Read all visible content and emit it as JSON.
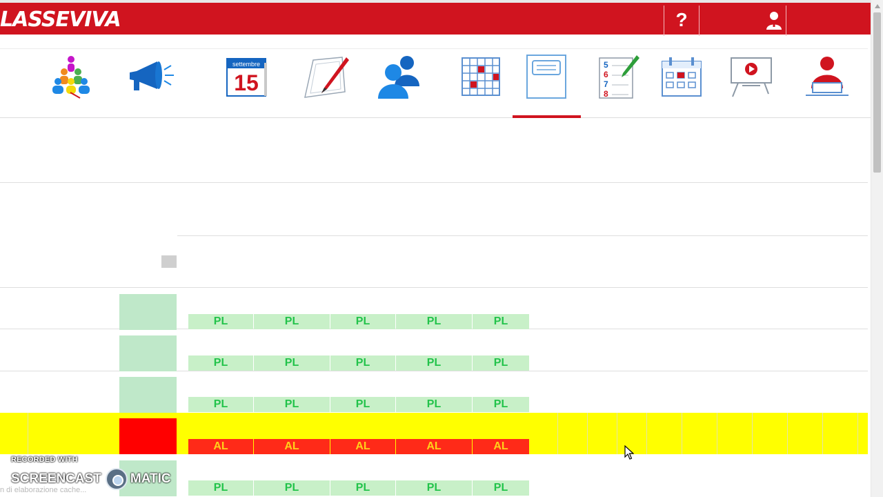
{
  "header": {
    "logo_text": "LASSEVIVA",
    "help_label": "?",
    "brand_color": "#d0141f"
  },
  "nav": {
    "icons": [
      "class-group-icon",
      "megaphone-icon",
      "calendar-icon",
      "notebook-pen-icon",
      "people-icon",
      "grid-calendar-icon",
      "register-book-icon",
      "grades-list-icon",
      "planner-calendar-icon",
      "video-board-icon",
      "teacher-desk-icon"
    ],
    "calendar_month": "settembre",
    "calendar_day": "15",
    "grades_numbers": [
      "5",
      "6",
      "7",
      "8"
    ],
    "active_index": 6
  },
  "grid": {
    "rows": [
      {
        "cells": [
          "PL",
          "PL",
          "PL",
          "PL",
          "PL"
        ],
        "highlight": false
      },
      {
        "cells": [
          "PL",
          "PL",
          "PL",
          "PL",
          "PL"
        ],
        "highlight": false
      },
      {
        "cells": [
          "PL",
          "PL",
          "PL",
          "PL",
          "PL"
        ],
        "highlight": false
      },
      {
        "cells": [
          "AL",
          "AL",
          "AL",
          "AL",
          "AL"
        ],
        "highlight": true
      },
      {
        "cells": [
          "PL",
          "PL",
          "PL",
          "PL",
          "PL"
        ],
        "highlight": false
      }
    ],
    "present_color": "#22c34a",
    "absent_color": "#ff2a18",
    "highlight_color": "#ffff00"
  },
  "watermark": {
    "recorded_with": "RECORDED WITH",
    "brand_left": "SCREENCAST",
    "brand_right": "MATIC"
  },
  "status_text": "n di elaborazione cache..."
}
